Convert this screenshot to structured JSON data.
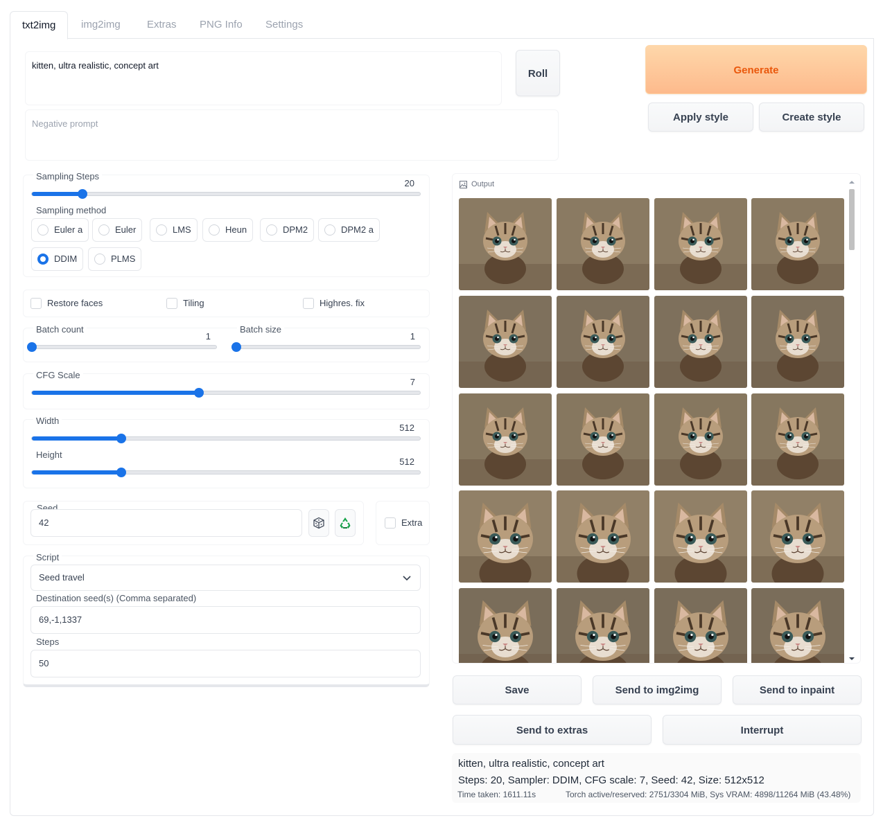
{
  "tabs": [
    "txt2img",
    "img2img",
    "Extras",
    "PNG Info",
    "Settings"
  ],
  "prompt": {
    "positive": "kitten, ultra realistic, concept art",
    "negative_placeholder": "Negative prompt"
  },
  "buttons": {
    "roll": "Roll",
    "generate": "Generate",
    "apply_style": "Apply style",
    "create_style": "Create style"
  },
  "sampling_steps": {
    "label": "Sampling Steps",
    "value": "20",
    "fraction": 0.13
  },
  "sampling_method": {
    "label": "Sampling method",
    "options": [
      "Euler a",
      "Euler",
      "LMS",
      "Heun",
      "DPM2",
      "DPM2 a",
      "DDIM",
      "PLMS"
    ],
    "selected": "DDIM"
  },
  "checkboxes": {
    "restore_faces": "Restore faces",
    "tiling": "Tiling",
    "highres_fix": "Highres. fix",
    "extra": "Extra"
  },
  "batch_count": {
    "label": "Batch count",
    "value": "1",
    "fraction": 0.0
  },
  "batch_size": {
    "label": "Batch size",
    "value": "1",
    "fraction": 0.0
  },
  "cfg_scale": {
    "label": "CFG Scale",
    "value": "7",
    "fraction": 0.43
  },
  "width": {
    "label": "Width",
    "value": "512",
    "fraction": 0.23
  },
  "height": {
    "label": "Height",
    "value": "512",
    "fraction": 0.23
  },
  "seed": {
    "label": "Seed",
    "value": "42"
  },
  "script": {
    "label": "Script",
    "selected": "Seed travel",
    "destination_label": "Destination seed(s) (Comma separated)",
    "destination_value": "69,-1,1337",
    "steps_label": "Steps",
    "steps_value": "50"
  },
  "output": {
    "label": "Output",
    "image_count": 20
  },
  "actions": {
    "save": "Save",
    "send_img2img": "Send to img2img",
    "send_inpaint": "Send to inpaint",
    "send_extras": "Send to extras",
    "interrupt": "Interrupt"
  },
  "result": {
    "prompt": "kitten, ultra realistic, concept art",
    "params": "Steps: 20, Sampler: DDIM, CFG scale: 7, Seed: 42, Size: 512x512",
    "time": "Time taken: 1611.11s",
    "memory": "Torch active/reserved: 2751/3304 MiB, Sys VRAM: 4898/11264 MiB (43.48%)"
  },
  "colors": {
    "accent": "#1a73e8",
    "generate_bg": "#fdba8c",
    "generate_text": "#ea580c"
  }
}
